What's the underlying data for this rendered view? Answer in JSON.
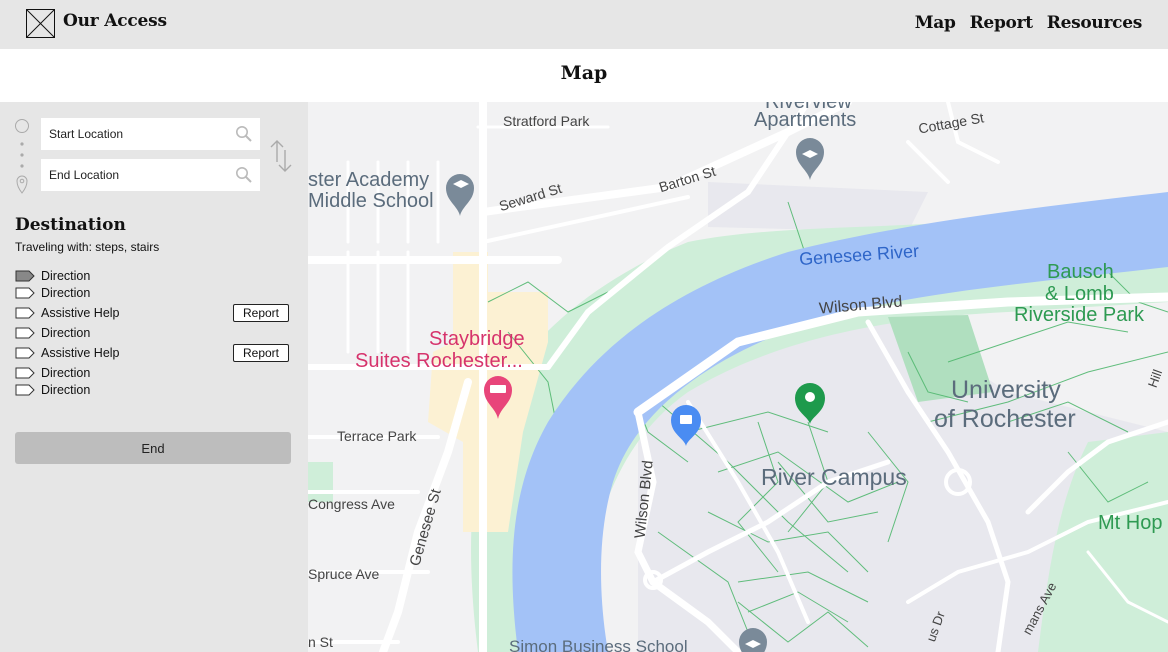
{
  "header": {
    "brand": "Our Access",
    "nav": [
      "Map",
      "Report",
      "Resources"
    ]
  },
  "page": {
    "title": "Map"
  },
  "route": {
    "start_placeholder": "Start Location",
    "end_placeholder": "End Location"
  },
  "destination": {
    "title": "Destination",
    "subtitle": "Traveling with: steps, stairs",
    "steps": [
      {
        "label": "Direction",
        "active": true
      },
      {
        "label": "Direction"
      },
      {
        "label": "Assistive Help",
        "action": "Report"
      },
      {
        "label": "Direction"
      },
      {
        "label": "Assistive Help",
        "action": "Report"
      },
      {
        "label": "Direction"
      },
      {
        "label": "Direction"
      }
    ],
    "end_label": "End"
  },
  "map": {
    "labels": {
      "riverview": "Riverview",
      "apartments": "Apartments",
      "stratford": "Stratford Park",
      "cottage": "Cottage St",
      "academy1": "ster Academy",
      "academy2": "Middle School",
      "seward": "Seward St",
      "barton": "Barton St",
      "genesee_river": "Genesee River",
      "bausch1": "Bausch",
      "bausch2": "& Lomb",
      "bausch3": "Riverside Park",
      "wilson_blvd_top": "Wilson Blvd",
      "staybridge1": "Staybridge",
      "staybridge2": "Suites Rochester...",
      "university1": "University",
      "university2": "of Rochester",
      "hill": "Hill",
      "terrace": "Terrace Park",
      "river_campus": "River Campus",
      "congress": "Congress Ave",
      "genesee_st": "Genesee St",
      "wilson_blvd_side": "Wilson Blvd",
      "mt_hope": "Mt Hop",
      "spruce": "Spruce Ave",
      "simon": "Simon Business School",
      "n_st": "n St",
      "us_dr": "us Dr",
      "mans_ave": "mans Ave"
    },
    "colors": {
      "river": "#a3c2f7",
      "park": "#cdebd7",
      "campus": "#e6e6ec",
      "road": "#ffffff",
      "hotel_pin": "#e8457a",
      "green_pin": "#1e9a4c",
      "blue_pin": "#4a8cf2",
      "school_pin": "#7a8a99"
    }
  }
}
